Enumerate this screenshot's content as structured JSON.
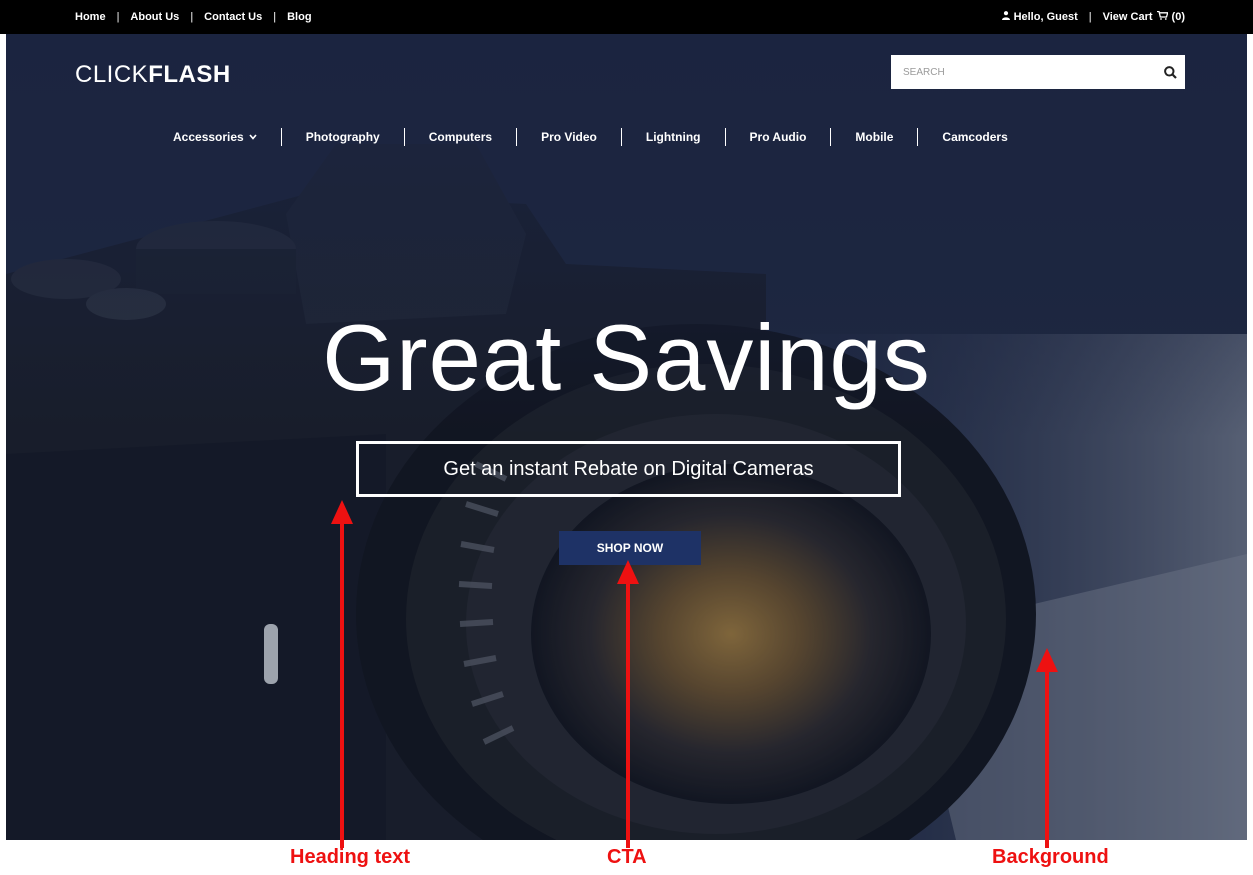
{
  "topbar": {
    "links": [
      "Home",
      "About Us",
      "Contact Us",
      "Blog"
    ],
    "greeting": "Hello, Guest",
    "view_cart": "View Cart",
    "cart_count": "(0)"
  },
  "brand": {
    "logo_thin": "CLICK",
    "logo_bold": "FLASH"
  },
  "search": {
    "placeholder": "SEARCH"
  },
  "nav": {
    "items": [
      "Accessories",
      "Photography",
      "Computers",
      "Pro Video",
      "Lightning",
      "Pro Audio",
      "Mobile",
      "Camcoders"
    ]
  },
  "hero": {
    "headline": "Great Savings",
    "subheadline": "Get an instant Rebate on Digital Cameras",
    "cta_label": "SHOP NOW"
  },
  "annotations": {
    "heading_text": "Heading text",
    "cta": "CTA",
    "background": "Background"
  },
  "colors": {
    "topbar": "#000000",
    "hero_overlay": "#1d2741",
    "cta": "#1e3266",
    "annotation": "#ee1111"
  },
  "icons": [
    "user-icon",
    "cart-icon",
    "search-icon",
    "chevron-down-icon"
  ]
}
